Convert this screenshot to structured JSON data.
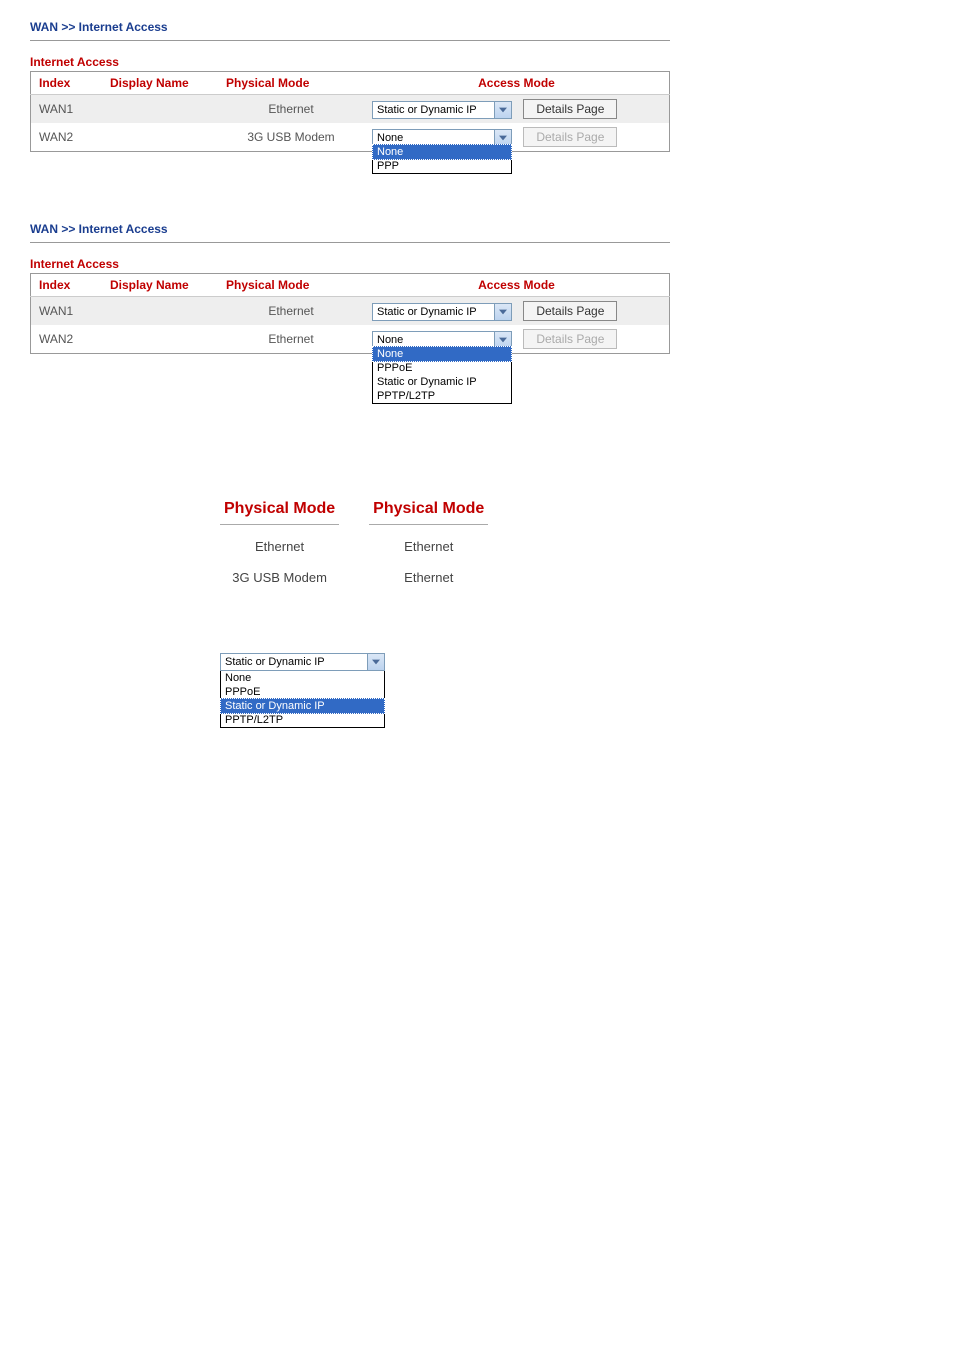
{
  "breadcrumb": "WAN >> Internet Access",
  "section_title": "Internet Access",
  "columns": {
    "index": "Index",
    "display": "Display Name",
    "physical": "Physical Mode",
    "access": "Access Mode"
  },
  "details_btn": "Details Page",
  "panel_a": {
    "rows": {
      "r1": {
        "idx": "WAN1",
        "disp": "",
        "phy": "Ethernet",
        "sel": "Static or Dynamic IP",
        "btn_enabled": true
      },
      "r2": {
        "idx": "WAN2",
        "disp": "",
        "phy": "3G USB Modem",
        "sel": "None",
        "btn_enabled": false
      }
    },
    "dropdown": {
      "items": [
        "None",
        "PPP"
      ],
      "selected": "None"
    }
  },
  "panel_b": {
    "rows": {
      "r1": {
        "idx": "WAN1",
        "disp": "",
        "phy": "Ethernet",
        "sel": "Static or Dynamic IP",
        "btn_enabled": true
      },
      "r2": {
        "idx": "WAN2",
        "disp": "",
        "phy": "Ethernet",
        "sel": "None",
        "btn_enabled": false
      }
    },
    "dropdown": {
      "items": [
        "None",
        "PPPoE",
        "Static or Dynamic IP",
        "PPTP/L2TP"
      ],
      "selected": "None"
    }
  },
  "compare": {
    "head": "Physical Mode",
    "left": {
      "r1": "Ethernet",
      "r2": "3G USB Modem"
    },
    "right": {
      "r1": "Ethernet",
      "r2": "Ethernet"
    }
  },
  "standalone": {
    "sel": "Static or Dynamic IP",
    "dropdown": {
      "items": [
        "None",
        "PPPoE",
        "Static or Dynamic IP",
        "PPTP/L2TP"
      ],
      "selected": "Static or Dynamic IP"
    }
  }
}
